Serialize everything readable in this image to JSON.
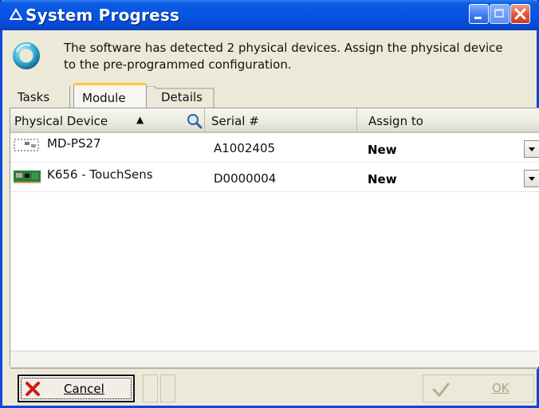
{
  "window": {
    "title": "System Progress"
  },
  "info": {
    "message": "The software has detected 2 physical devices. Assign the physical device to the pre-programmed configuration."
  },
  "tabs": [
    {
      "label": "Tasks",
      "active": false
    },
    {
      "label": "Module",
      "active": true
    },
    {
      "label": "Details",
      "active": false
    }
  ],
  "table": {
    "columns": [
      "Physical Device",
      "Serial #",
      "Assign to"
    ],
    "sort": {
      "column": "Physical Device",
      "direction": "ascending"
    },
    "rows": [
      {
        "device": "MD-PS27",
        "serial": "A1002405",
        "assign": "New",
        "icon": "module-icon"
      },
      {
        "device": "K656 - TouchSens",
        "serial": "D0000004",
        "assign": "New",
        "icon": "circuit-board-icon"
      }
    ]
  },
  "buttons": {
    "cancel": "Cancel",
    "ok": "OK"
  },
  "colors": {
    "titlebar": "#0754e6",
    "window_bg": "#ece9d8",
    "active_tab_accent": "#ffc83c",
    "close_button": "#e2583e"
  }
}
